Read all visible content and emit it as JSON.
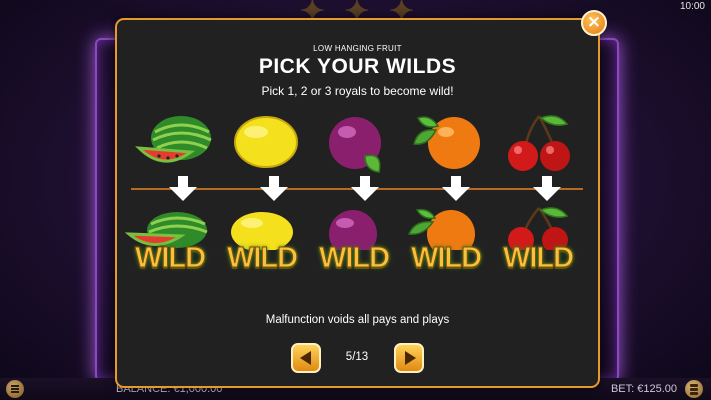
{
  "status_bar": {
    "time": "10:00"
  },
  "modal": {
    "overline": "LOW HANGING FRUIT",
    "title": "PICK YOUR WILDS",
    "subtitle": "Pick 1, 2 or 3 royals to become wild!",
    "wild_label": "WILD",
    "fruits": [
      {
        "name": "watermelon"
      },
      {
        "name": "lemon"
      },
      {
        "name": "plum"
      },
      {
        "name": "orange"
      },
      {
        "name": "cherries"
      }
    ],
    "disclaimer": "Malfunction voids all pays and plays",
    "close_icon": "×",
    "pagination": {
      "current": 5,
      "total": 13,
      "label": "5/13"
    }
  },
  "footer": {
    "balance_label": "BALANCE: €1,000.00",
    "bet_label": "BET: €125.00"
  },
  "colors": {
    "modal_border": "#e79a2c",
    "modal_bg": "#222121",
    "wild_text": "#f3c440",
    "divider": "#b86a24"
  }
}
